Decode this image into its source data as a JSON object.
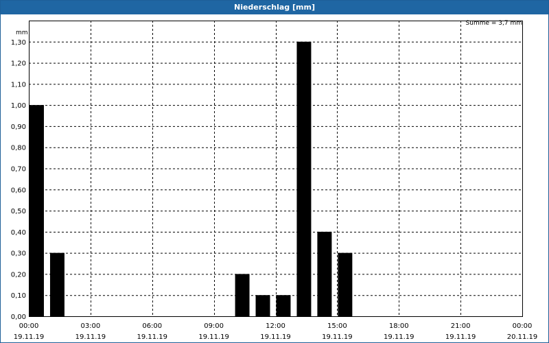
{
  "window": {
    "title": "Niederschlag [mm]"
  },
  "chart_data": {
    "type": "bar",
    "title": "Niederschlag [mm]",
    "ylabel": "mm",
    "annotation": "Summe = 3,7 mm",
    "ylim": [
      0,
      1.4
    ],
    "xlim_hours": [
      0,
      24
    ],
    "y_ticks": [
      {
        "v": 0.0,
        "label": "0,00"
      },
      {
        "v": 0.1,
        "label": "0,10"
      },
      {
        "v": 0.2,
        "label": "0,20"
      },
      {
        "v": 0.3,
        "label": "0,30"
      },
      {
        "v": 0.4,
        "label": "0,40"
      },
      {
        "v": 0.5,
        "label": "0,50"
      },
      {
        "v": 0.6,
        "label": "0,60"
      },
      {
        "v": 0.7,
        "label": "0,70"
      },
      {
        "v": 0.8,
        "label": "0,80"
      },
      {
        "v": 0.9,
        "label": "0,90"
      },
      {
        "v": 1.0,
        "label": "1,00"
      },
      {
        "v": 1.1,
        "label": "1,10"
      },
      {
        "v": 1.2,
        "label": "1,20"
      },
      {
        "v": 1.3,
        "label": "1,30"
      }
    ],
    "x_ticks": [
      {
        "h": 0,
        "time": "00:00",
        "date": "19.11.19"
      },
      {
        "h": 3,
        "time": "03:00",
        "date": "19.11.19"
      },
      {
        "h": 6,
        "time": "06:00",
        "date": "19.11.19"
      },
      {
        "h": 9,
        "time": "09:00",
        "date": "19.11.19"
      },
      {
        "h": 12,
        "time": "12:00",
        "date": "19.11.19"
      },
      {
        "h": 15,
        "time": "15:00",
        "date": "19.11.19"
      },
      {
        "h": 18,
        "time": "18:00",
        "date": "19.11.19"
      },
      {
        "h": 21,
        "time": "21:00",
        "date": "19.11.19"
      },
      {
        "h": 24,
        "time": "00:00",
        "date": "20.11.19"
      }
    ],
    "bars": [
      {
        "h": 0,
        "value": 1.0
      },
      {
        "h": 1,
        "value": 0.3
      },
      {
        "h": 10,
        "value": 0.2
      },
      {
        "h": 11,
        "value": 0.1
      },
      {
        "h": 12,
        "value": 0.1
      },
      {
        "h": 13,
        "value": 1.3
      },
      {
        "h": 14,
        "value": 0.4
      },
      {
        "h": 15,
        "value": 0.3
      }
    ],
    "colors": {
      "bar": "#000000",
      "grid": "#000000",
      "title_bg": "#1f66a3"
    },
    "grid": true
  }
}
